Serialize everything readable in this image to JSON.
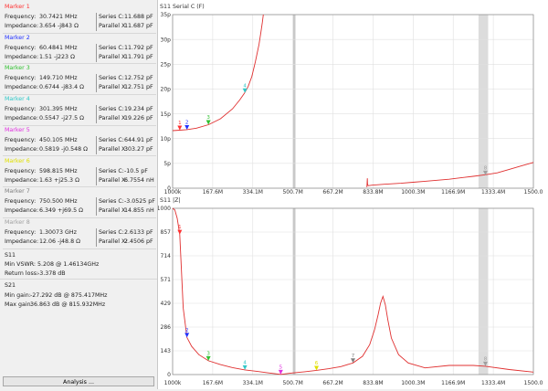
{
  "markers": [
    {
      "title": "Marker 1",
      "color": "#ff3030",
      "freq_label": "Frequency:",
      "freq": "30.7421  MHz",
      "imp_label": "Impedance:",
      "imp": "3.654 -j843 Ω",
      "r1_label": "Series C:",
      "r1": "11.688  pF",
      "r2_label": "Parallel X:",
      "r2": "11.687  pF"
    },
    {
      "title": "Marker 2",
      "color": "#2030ff",
      "freq_label": "Frequency:",
      "freq": "60.4841  MHz",
      "imp_label": "Impedance:",
      "imp": "1.51 -j223 Ω",
      "r1_label": "Series C:",
      "r1": "11.792  pF",
      "r2_label": "Parallel X:",
      "r2": "11.791  pF"
    },
    {
      "title": "Marker 3",
      "color": "#30c030",
      "freq_label": "Frequency:",
      "freq": "149.710  MHz",
      "imp_label": "Impedance:",
      "imp": "0.6744 -j83.4 Ω",
      "r1_label": "Series C:",
      "r1": "12.752  pF",
      "r2_label": "Parallel X:",
      "r2": "12.751  pF"
    },
    {
      "title": "Marker 4",
      "color": "#30c8c8",
      "freq_label": "Frequency:",
      "freq": "301.395  MHz",
      "imp_label": "Impedance:",
      "imp": "0.5547 -j27.5 Ω",
      "r1_label": "Series C:",
      "r1": "19.234  pF",
      "r2_label": "Parallel X:",
      "r2": "19.226  pF"
    },
    {
      "title": "Marker 5",
      "color": "#e030e0",
      "freq_label": "Frequency:",
      "freq": "450.105  MHz",
      "imp_label": "Impedance:",
      "imp": "0.5819 -j0.548 Ω",
      "r1_label": "Series C:",
      "r1": "644.91  pF",
      "r2_label": "Parallel X:",
      "r2": "303.27  pF"
    },
    {
      "title": "Marker 6",
      "color": "#e0e000",
      "freq_label": "Frequency:",
      "freq": "598.815  MHz",
      "imp_label": "Impedance:",
      "imp": "1.63 +j25.3 Ω",
      "r1_label": "Series C:",
      "r1": "-10.5  pF",
      "r2_label": "Parallel X:",
      "r2": "6.7554  nH"
    },
    {
      "title": "Marker 7",
      "color": "#808080",
      "freq_label": "Frequency:",
      "freq": "750.500  MHz",
      "imp_label": "Impedance:",
      "imp": "6.349 +j69.5 Ω",
      "r1_label": "Series C:",
      "r1": "-3.0525  pF",
      "r2_label": "Parallel X:",
      "r2": "14.855  nH"
    },
    {
      "title": "Marker 8",
      "color": "#a0a0a0",
      "freq_label": "Frequency:",
      "freq": "1.30073  GHz",
      "imp_label": "Impedance:",
      "imp": "12.06 -j48.8 Ω",
      "r1_label": "Series C:",
      "r1": "2.6133  pF",
      "r2_label": "Parallel X:",
      "r2": "2.4506  pF"
    }
  ],
  "s11": {
    "title": "S11",
    "vswr_label": "Min VSWR:",
    "vswr": "5.208 @ 1.46134GHz",
    "rl_label": "Return loss:",
    "rl": "-3.378 dB"
  },
  "s21": {
    "title": "S21",
    "min_label": "Min gain:",
    "min": "-27.292 dB @ 875.417MHz",
    "max_label": "Max gain:",
    "max": "36.863 dB @ 815.932MHz"
  },
  "analysis_button": "Analysis ...",
  "x_ticks": [
    "1000k",
    "167.6M",
    "334.1M",
    "500.7M",
    "667.2M",
    "833.8M",
    "1000.3M",
    "1166.9M",
    "1333.4M",
    "1500.0"
  ],
  "chart_data": [
    {
      "type": "line",
      "title": "S11 Serial C (F)",
      "ylim": [
        0,
        35
      ],
      "yticks": [
        "0",
        "5p",
        "10p",
        "15p",
        "20p",
        "25p",
        "30p",
        "35p"
      ],
      "xlim_mhz": [
        1,
        1500
      ],
      "line_color": "#e03030",
      "marker_labels": [
        "1",
        "2",
        "3",
        "4",
        "8"
      ],
      "marker_mhz": [
        30.7,
        60.5,
        149.7,
        301.4,
        1300.7
      ],
      "marker_values": [
        11.7,
        11.8,
        12.8,
        19.2,
        2.6
      ],
      "series": [
        {
          "x": [
            1,
            30,
            60,
            100,
            150,
            200,
            250,
            280,
            300,
            315,
            330,
            345,
            360,
            368,
            374,
            378
          ],
          "y": [
            11.6,
            11.7,
            11.8,
            12.1,
            12.8,
            14,
            16,
            17.8,
            19.2,
            20.5,
            22.5,
            25.5,
            29,
            31.5,
            33.5,
            35
          ]
        },
        {
          "x": [
            808,
            810,
            811,
            813,
            830,
            880,
            950,
            1000,
            1050,
            1100,
            1150,
            1200,
            1250,
            1300,
            1350,
            1400,
            1450,
            1500
          ],
          "y": [
            0.2,
            2,
            0.9,
            0.5,
            0.6,
            0.8,
            1,
            1.2,
            1.4,
            1.6,
            1.8,
            2.1,
            2.4,
            2.7,
            3.1,
            3.8,
            4.5,
            5.2
          ]
        }
      ]
    },
    {
      "type": "line",
      "title": "S11 |Z|",
      "ylim": [
        0,
        1000
      ],
      "yticks": [
        "0",
        "143",
        "286",
        "429",
        "571",
        "714",
        "857",
        "1000"
      ],
      "xlim_mhz": [
        1,
        1500
      ],
      "line_color": "#e03030",
      "marker_labels": [
        "1",
        "2",
        "3",
        "4",
        "5",
        "6",
        "7",
        "8"
      ],
      "marker_mhz": [
        30.7,
        60.5,
        149.7,
        301.4,
        450.1,
        598.8,
        750.5,
        1300.7
      ],
      "marker_values": [
        843,
        223,
        83,
        28,
        1,
        25,
        70,
        50
      ],
      "series": [
        {
          "x": [
            1,
            10,
            20,
            30.7,
            45,
            60.5,
            80,
            110,
            149.7,
            200,
            250,
            301.4,
            350,
            400,
            450.1,
            500,
            550,
            598.8,
            650,
            700,
            750.5,
            790,
            820,
            840,
            855,
            865,
            875,
            885,
            895,
            910,
            940,
            980,
            1050,
            1150,
            1250,
            1300.7,
            1400,
            1500
          ],
          "y": [
            1000,
            990,
            940,
            843,
            400,
            223,
            170,
            120,
            83,
            60,
            42,
            28,
            20,
            10,
            1,
            10,
            17,
            25,
            35,
            48,
            70,
            110,
            180,
            270,
            360,
            430,
            470,
            420,
            330,
            220,
            120,
            70,
            40,
            55,
            55,
            50,
            30,
            15
          ]
        }
      ]
    }
  ]
}
